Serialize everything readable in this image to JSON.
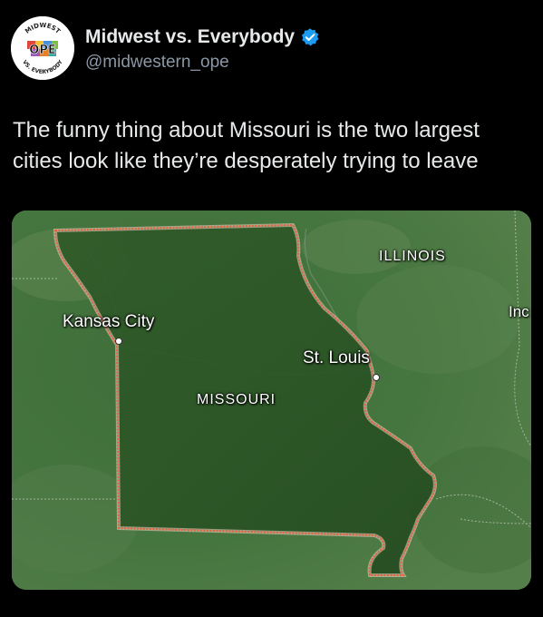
{
  "account": {
    "display_name": "Midwest vs. Everybody",
    "handle": "@midwestern_ope",
    "avatar": {
      "top_text": "MIDWEST",
      "center_text": "OPE",
      "bottom_text": "VS. EVERYBODY"
    },
    "verified_icon": "verified-badge-icon",
    "verified_color": "#1d9bf0"
  },
  "tweet": {
    "text": "The funny thing about Missouri is the two largest\ncities look like they’re desperately trying to leave"
  },
  "map": {
    "labels": {
      "kansas_city": "Kansas City",
      "st_louis": "St. Louis",
      "missouri": "MISSOURI",
      "illinois": "ILLINOIS",
      "indiana_partial": "Inc"
    },
    "border_color": "#e8603c"
  }
}
